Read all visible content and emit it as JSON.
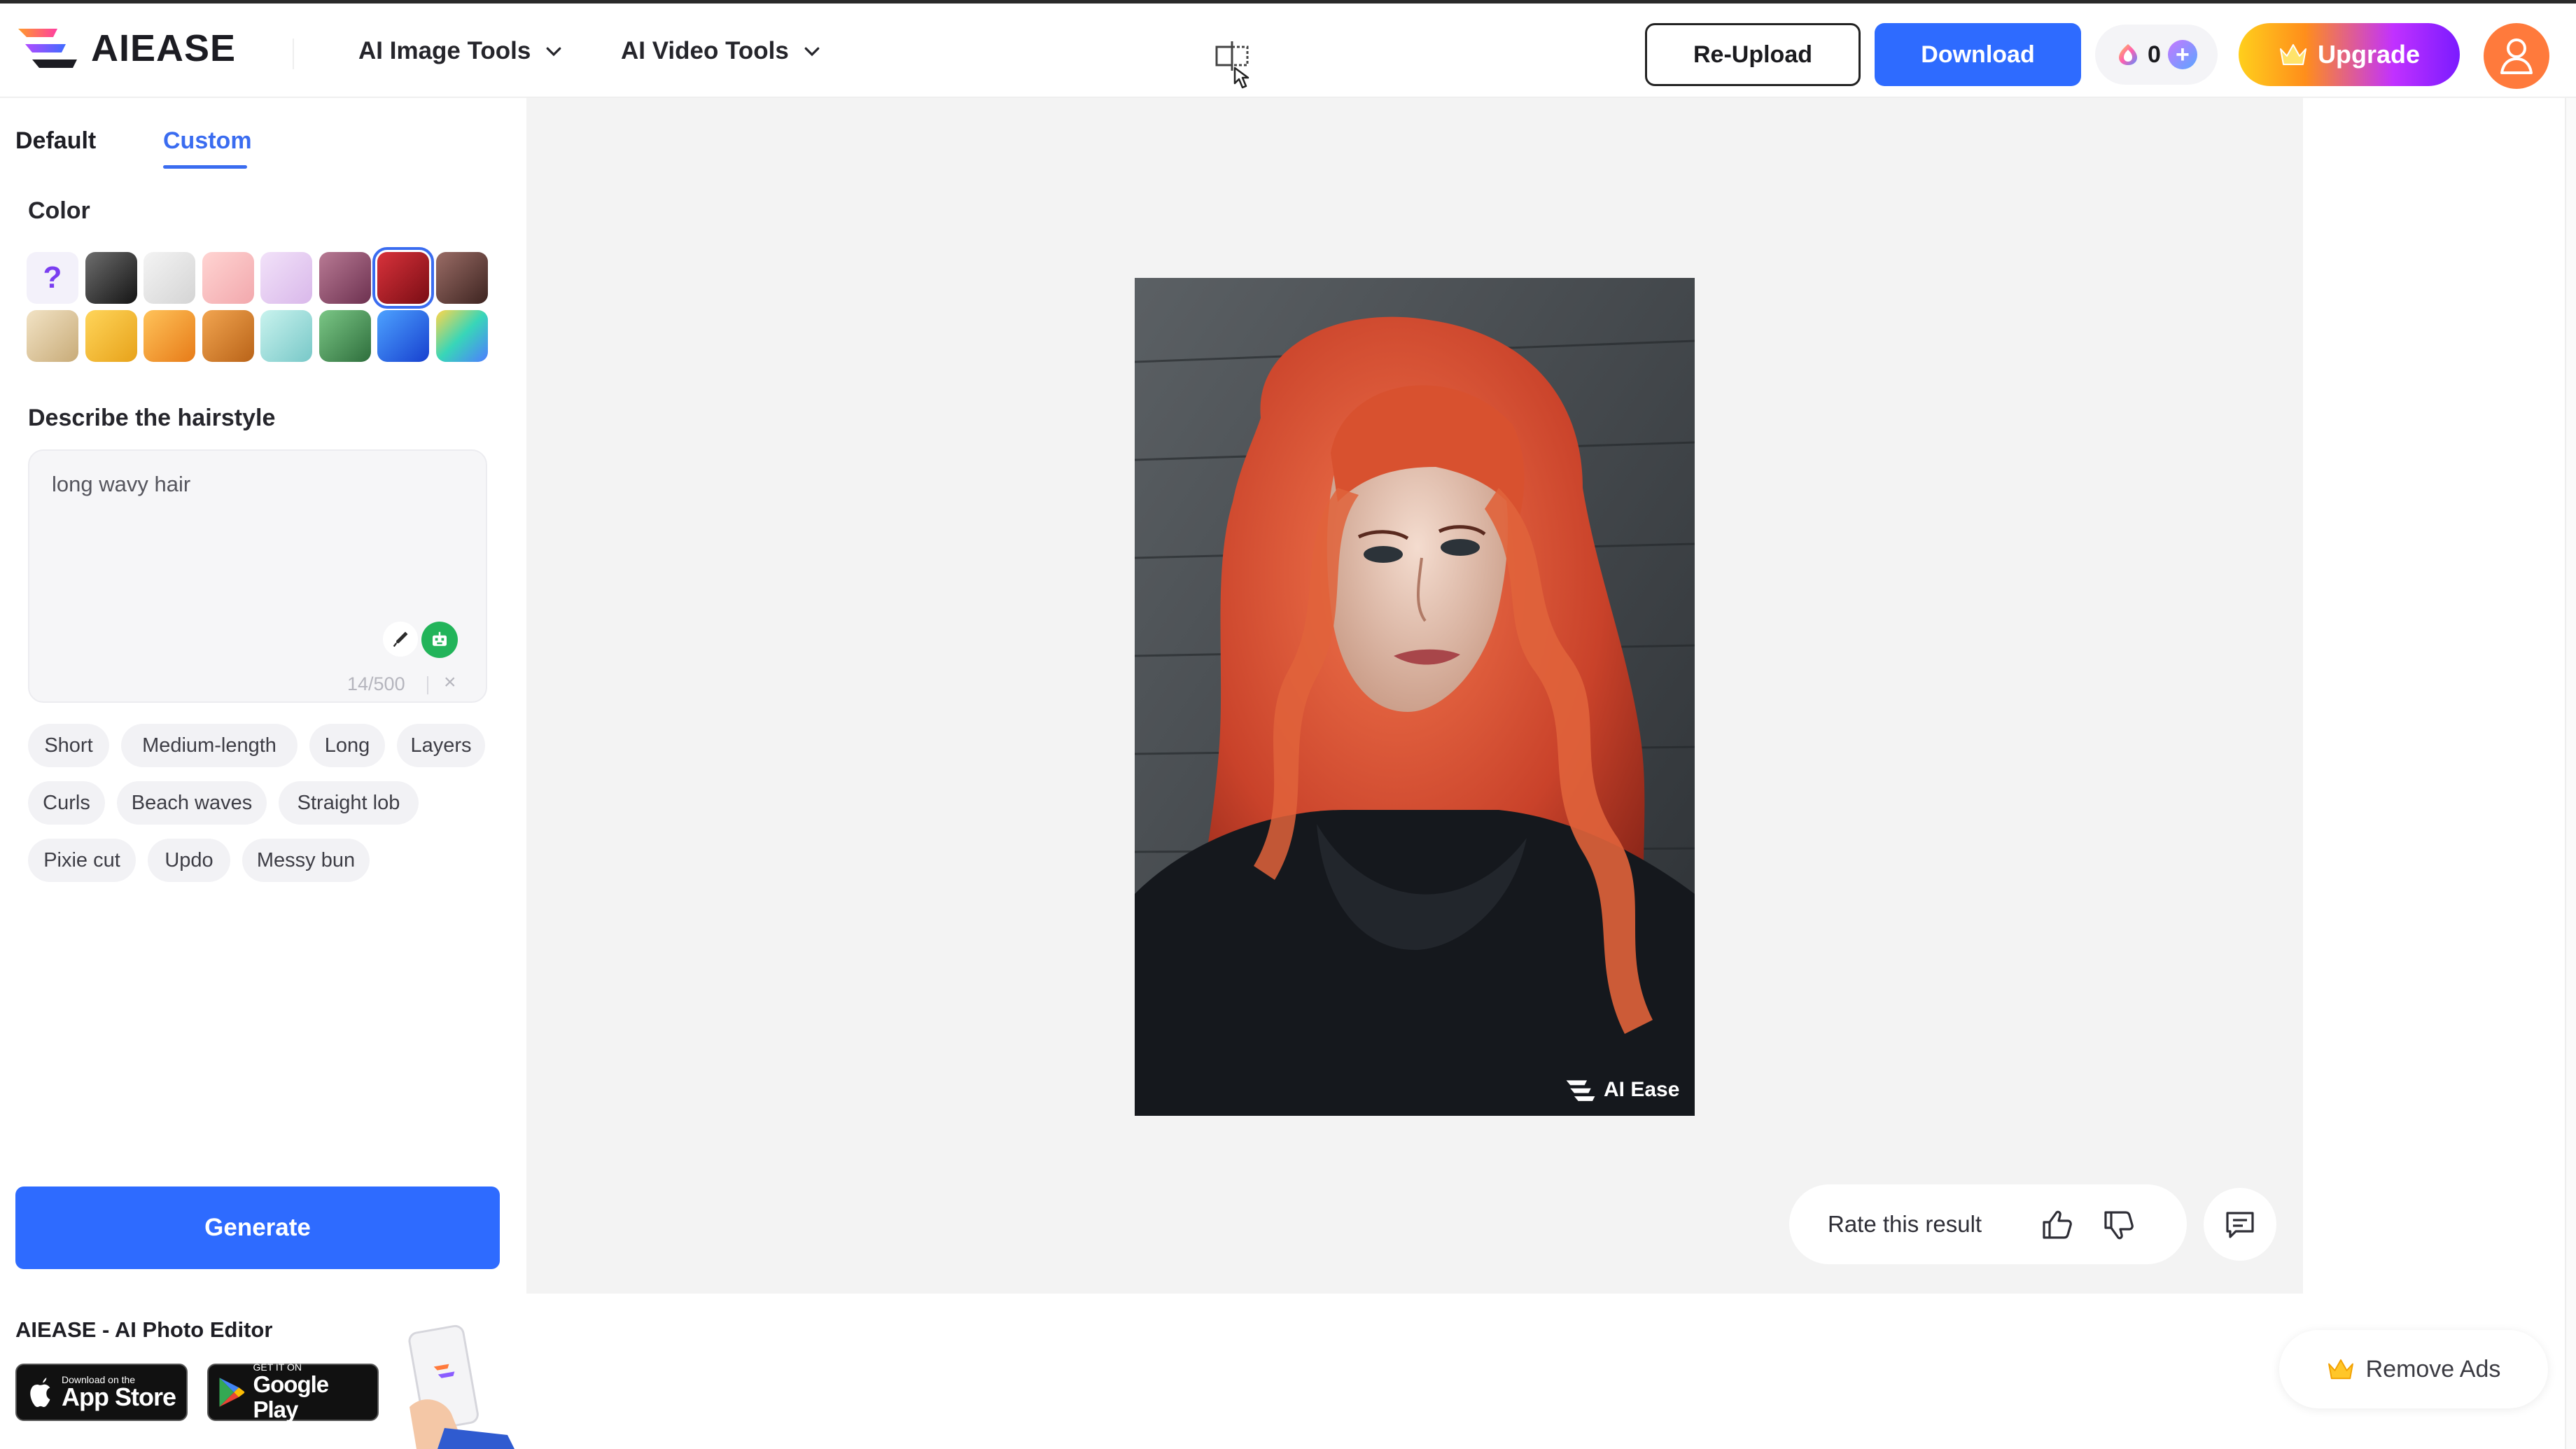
{
  "header": {
    "brand": "AIEASE",
    "nav": [
      {
        "label": "AI Image Tools"
      },
      {
        "label": "AI Video Tools"
      }
    ],
    "reupload_label": "Re-Upload",
    "download_label": "Download",
    "credits": "0",
    "credits_plus": "+",
    "upgrade_label": "Upgrade"
  },
  "sidebar": {
    "tabs": [
      {
        "label": "Default",
        "active": false
      },
      {
        "label": "Custom",
        "active": true
      }
    ],
    "color_label": "Color",
    "swatches": [
      {
        "name": "unknown",
        "bg": "#f3f1fa",
        "symbol": "?"
      },
      {
        "name": "black",
        "bg": "linear-gradient(135deg,#6e6e6e,#141414)"
      },
      {
        "name": "silver",
        "bg": "linear-gradient(135deg,#f4f4f4,#d4d4d4)"
      },
      {
        "name": "pink",
        "bg": "linear-gradient(135deg,#ffd4d2,#f2a8ad)"
      },
      {
        "name": "lavender",
        "bg": "linear-gradient(135deg,#f2e2f9,#d9b8ea)"
      },
      {
        "name": "plum",
        "bg": "linear-gradient(135deg,#b87a94,#6d3150)"
      },
      {
        "name": "red",
        "bg": "linear-gradient(135deg,#d8323b,#7a0d14)",
        "selected": true
      },
      {
        "name": "brown",
        "bg": "linear-gradient(135deg,#9a6c66,#3d2420)"
      },
      {
        "name": "blonde",
        "bg": "linear-gradient(135deg,#f2e3c5,#c8ab78)"
      },
      {
        "name": "golden",
        "bg": "linear-gradient(135deg,#ffd55a,#e7a21a)"
      },
      {
        "name": "orange",
        "bg": "linear-gradient(135deg,#ffc35a,#e77b18)"
      },
      {
        "name": "copper",
        "bg": "linear-gradient(135deg,#f2a550,#b96318)"
      },
      {
        "name": "mint",
        "bg": "linear-gradient(135deg,#c9f3ee,#78c8c8)"
      },
      {
        "name": "green",
        "bg": "linear-gradient(135deg,#7bc786,#2e6e3c)"
      },
      {
        "name": "blue",
        "bg": "linear-gradient(135deg,#4da2ff,#1740cf)"
      },
      {
        "name": "rainbow",
        "bg": "linear-gradient(135deg,#ffd64a,#38d6b8 50%,#4d7dff)"
      }
    ],
    "describe_label": "Describe the hairstyle",
    "description": "long wavy hair",
    "counter": "14/500",
    "clear": "×",
    "chips": [
      "Short",
      "Medium-length",
      "Long",
      "Layers",
      "Curls",
      "Beach waves",
      "Straight lob",
      "Pixie cut",
      "Updo",
      "Messy bun"
    ],
    "generate_label": "Generate",
    "app_title": "AIEASE - AI Photo Editor",
    "appstore_small": "Download on the",
    "appstore_big": "App Store",
    "googleplay_small": "GET IT ON",
    "googleplay_big": "Google Play"
  },
  "canvas": {
    "watermark": "AI Ease",
    "rate_label": "Rate this result"
  },
  "remove_ads_label": "Remove Ads",
  "colors": {
    "primary": "#2e6bff",
    "tab_active": "#3a6cf0",
    "avatar": "#ff7a3c",
    "ai_green": "#22b45a"
  }
}
